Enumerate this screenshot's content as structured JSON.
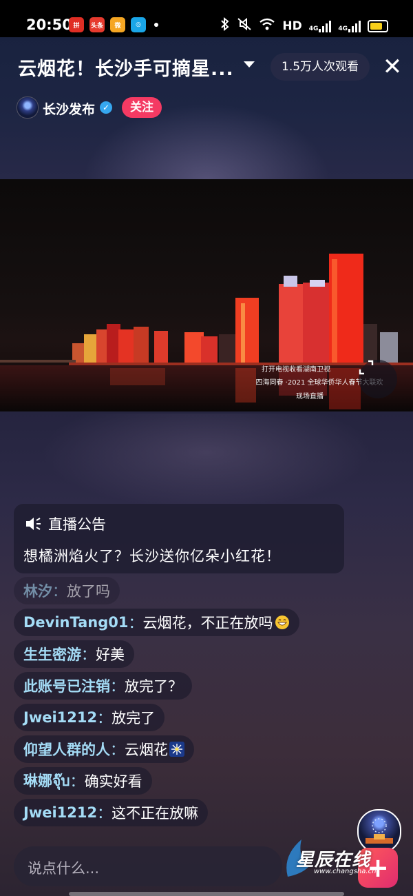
{
  "status_bar": {
    "time": "20:50",
    "app_icons": [
      {
        "name": "pinduoduo-icon",
        "color": "#e02e24",
        "text": "拼"
      },
      {
        "name": "toutiao-icon",
        "color": "#e63a2e",
        "text": "头条"
      },
      {
        "name": "weibo-icon",
        "color": "#f5a623",
        "text": "微"
      },
      {
        "name": "app-icon",
        "color": "#1aa6e8",
        "text": "◎"
      }
    ],
    "hd_label": "HD",
    "network_1": "4G",
    "network_2": "4G"
  },
  "header": {
    "title": "云烟花！长沙手可摘星...",
    "viewers": "1.5万人次观看",
    "account_name": "长沙发布",
    "follow_label": "关注"
  },
  "video": {
    "caption_line1": "打开电视收看湖南卫视",
    "caption_line2": "四海同春 ·2021 全球华侨华人春节大联欢",
    "caption_line3": "现场直播"
  },
  "announcement": {
    "title": "直播公告",
    "body": "想橘洲焰火了？长沙送你亿朵小红花！"
  },
  "comments": [
    {
      "user": "林汐",
      "sep": "：",
      "text": "放了吗",
      "emoji": "",
      "faded": true
    },
    {
      "user": "DevinTang01",
      "sep": "：",
      "text": "云烟花，不正在放吗",
      "emoji": "grin"
    },
    {
      "user": "生生密游",
      "sep": "：",
      "text": "好美",
      "emoji": ""
    },
    {
      "user": "此账号已注销",
      "sep": "：",
      "text": "放完了？",
      "emoji": ""
    },
    {
      "user": "Jwei1212",
      "sep": "：",
      "text": "放完了",
      "emoji": ""
    },
    {
      "user": "仰望人群的人",
      "sep": "：",
      "text": "云烟花",
      "emoji": "fireworks"
    },
    {
      "user": "琳娜จุ๊บ",
      "sep": "：",
      "text": "确实好看",
      "emoji": ""
    },
    {
      "user": "Jwei1212",
      "sep": "：",
      "text": "这不正在放嘛",
      "emoji": ""
    }
  ],
  "input": {
    "placeholder": "说点什么..."
  },
  "watermark": {
    "text": "星辰在线",
    "url": "www.changsha.cn"
  },
  "colors": {
    "follow": "#f43a63",
    "username": "#a4dcf6",
    "verified": "#36a7ef",
    "accent_plus": "#ff5a5a"
  }
}
